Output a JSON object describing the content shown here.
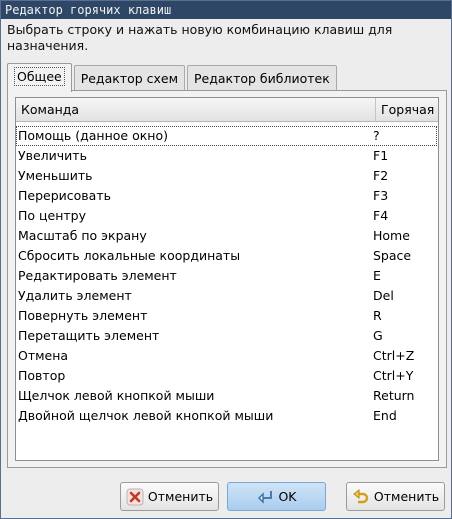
{
  "window": {
    "title": "Редактор горячих клавиш"
  },
  "instruction": "Выбрать строку и нажать новую комбинацию клавиш для назначения.",
  "tabs": [
    {
      "label": "Общее",
      "active": true
    },
    {
      "label": "Редактор схем",
      "active": false
    },
    {
      "label": "Редактор библиотек",
      "active": false
    }
  ],
  "table": {
    "columns": [
      "Команда",
      "Горячая к"
    ],
    "rows": [
      {
        "command": "Помощь (данное окно)",
        "hotkey": "?"
      },
      {
        "command": "Увеличить",
        "hotkey": "F1"
      },
      {
        "command": "Уменьшить",
        "hotkey": "F2"
      },
      {
        "command": "Перерисовать",
        "hotkey": "F3"
      },
      {
        "command": "По центру",
        "hotkey": "F4"
      },
      {
        "command": "Масштаб по экрану",
        "hotkey": "Home"
      },
      {
        "command": "Сбросить локальные координаты",
        "hotkey": "Space"
      },
      {
        "command": "Редактировать элемент",
        "hotkey": "E"
      },
      {
        "command": "Удалить элемент",
        "hotkey": "Del"
      },
      {
        "command": "Повернуть элемент",
        "hotkey": "R"
      },
      {
        "command": "Перетащить элемент",
        "hotkey": "G"
      },
      {
        "command": "Отмена",
        "hotkey": "Ctrl+Z"
      },
      {
        "command": "Повтор",
        "hotkey": "Ctrl+Y"
      },
      {
        "command": "Щелчок левой кнопкой мыши",
        "hotkey": "Return"
      },
      {
        "command": "Двойной щелчок левой кнопкой мыши",
        "hotkey": "End"
      }
    ]
  },
  "buttons": {
    "cancel": "Отменить",
    "ok": "OK",
    "revert": "Отменить"
  },
  "colors": {
    "titlebar": "#2f4766",
    "ok_button": "#a9cdee",
    "cancel_icon": "#c0392b",
    "ok_icon": "#3b6fa8",
    "revert_icon": "#d4a017"
  }
}
